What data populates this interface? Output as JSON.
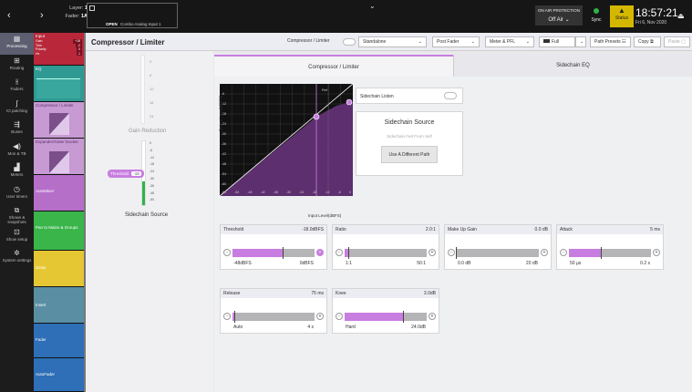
{
  "topbar": {
    "back": "‹",
    "forward": "›",
    "layer_label": "Layer:",
    "layer_value": "1",
    "fader_label": "Fader:",
    "fader_value": "1A",
    "open_label": "OPEN",
    "channel_name": "Combo Analog Input 1",
    "on_air_protection": "ON AIR PROTECTION",
    "on_air_value": "Off Air",
    "sync": "Sync",
    "status": "Status",
    "time": "18:57:21",
    "date": "Fri 6, Nov 2020"
  },
  "nav": [
    "Processing",
    "Routing",
    "Faders",
    "IO patching",
    "Buses",
    "Mon & TB",
    "Meters",
    "User timers",
    "Shows & snapshots",
    "Show setup",
    "System settings"
  ],
  "strip": {
    "input": "Input",
    "input_rows": [
      "Gain",
      "Trim",
      "Polarity",
      "Hz"
    ],
    "input_values": [
      "+18",
      "-2",
      "0",
      "1"
    ],
    "eq": "EQ",
    "compressor": "Compressor / Limiter",
    "expander": "Expander/Gate/ Ducker",
    "automixer": "AutoMixer",
    "pan": "Pan to Mains & Groups",
    "delay": "Delay",
    "insert": "Insert",
    "fader": "Fader",
    "autofader": "AutoFader"
  },
  "header": {
    "title": "Compressor / Limiter",
    "comp_label": "Compressor / Limiter",
    "standalone": "Standalone",
    "post_fader": "Post Fader",
    "meter": "Meter & PFL",
    "full": "Full",
    "presets": "Path Presets",
    "copy": "Copy",
    "paste": "Paste"
  },
  "left": {
    "gain_reduction": "Gain Reduction",
    "sidechain_source": "Sidechain Source",
    "threshold_tag": "Threshold",
    "threshold_tag_val": "-18",
    "gr_scale": [
      "0",
      "6",
      "12",
      "18",
      "24"
    ],
    "sc_scale": [
      "0",
      "-6",
      "-12",
      "-18",
      "-24",
      "-30",
      "-36",
      "-48",
      "-60"
    ]
  },
  "tabs": {
    "tab1": "Compressor / Limiter",
    "tab2": "Sidechain EQ"
  },
  "graph": {
    "ylabel": "Output Level(dBFS)",
    "xlabel": "Input Level(dBFS)",
    "ref": "Ref",
    "ticks": [
      "-60",
      "-54",
      "-48",
      "-42",
      "-36",
      "-30",
      "-24",
      "-18",
      "-12",
      "-6",
      "0"
    ]
  },
  "sidechain": {
    "listen": "Sidechain Listen",
    "source_title": "Sidechain Source",
    "fed": "Sidechain Fed From Self",
    "use_diff": "Use A Different Path"
  },
  "params": {
    "threshold": {
      "label": "Threshold",
      "value": "-18.0dBFS",
      "min": "-48dBFS",
      "max": "0dBFS"
    },
    "ratio": {
      "label": "Ratio",
      "value": "2.0:1",
      "min": "1:1",
      "max": "50:1"
    },
    "makeup": {
      "label": "Make Up Gain",
      "value": "0.0 dB",
      "min": "0.0 dB",
      "max": "20 dB"
    },
    "attack": {
      "label": "Attack",
      "value": "5 ms",
      "min": "50 µs",
      "max": "0.2 s"
    },
    "release": {
      "label": "Release",
      "value": "75 ms",
      "min": "Auto",
      "max": "4 s"
    },
    "knee": {
      "label": "Knee",
      "value": "3.0dB",
      "min": "Hard",
      "max": "24.0dB"
    }
  },
  "levels": {
    "threshold": 0.62,
    "ratio": 0.05,
    "makeup": 0.0,
    "attack": 0.4,
    "release": 0.03,
    "knee": 0.72
  },
  "colors": {
    "accent": "#c87de0",
    "purple_dark": "#5d2f6e",
    "green": "#2fb24b"
  }
}
